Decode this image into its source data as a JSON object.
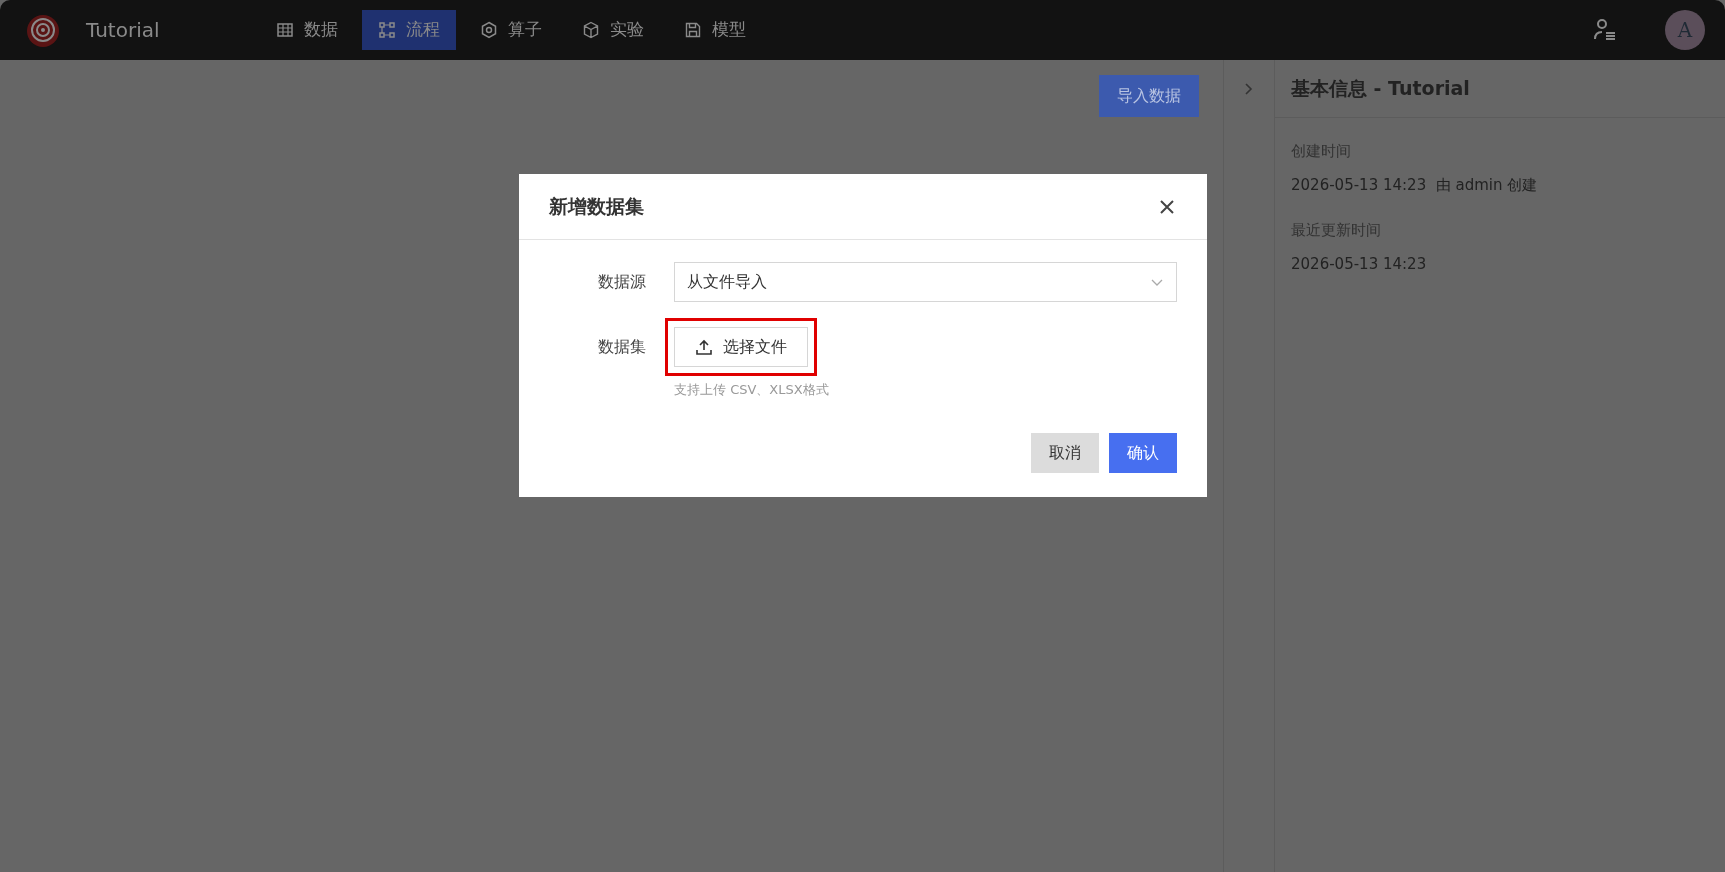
{
  "app": {
    "title": "Tutorial"
  },
  "nav": [
    {
      "label": "数据",
      "selected": false
    },
    {
      "label": "流程",
      "selected": true
    },
    {
      "label": "算子",
      "selected": false
    },
    {
      "label": "实验",
      "selected": false
    },
    {
      "label": "模型",
      "selected": false
    }
  ],
  "user": {
    "avatar": "A"
  },
  "toolbar": {
    "import_button": "导入数据"
  },
  "info_panel": {
    "title": "基本信息 - Tutorial",
    "fields": [
      {
        "label": "创建时间",
        "value": "2026-05-13 14:23  由 admin 创建"
      },
      {
        "label": "最近更新时间",
        "value": "2026-05-13 14:23"
      }
    ]
  },
  "dialog": {
    "title": "新增数据集",
    "source_label": "数据源",
    "source_value": "从文件导入",
    "dataset_label": "数据集",
    "upload_button": "选择文件",
    "upload_highlighted": true,
    "hint": "支持上传 CSV、XLSX格式",
    "cancel": "取消",
    "confirm": "确认"
  }
}
